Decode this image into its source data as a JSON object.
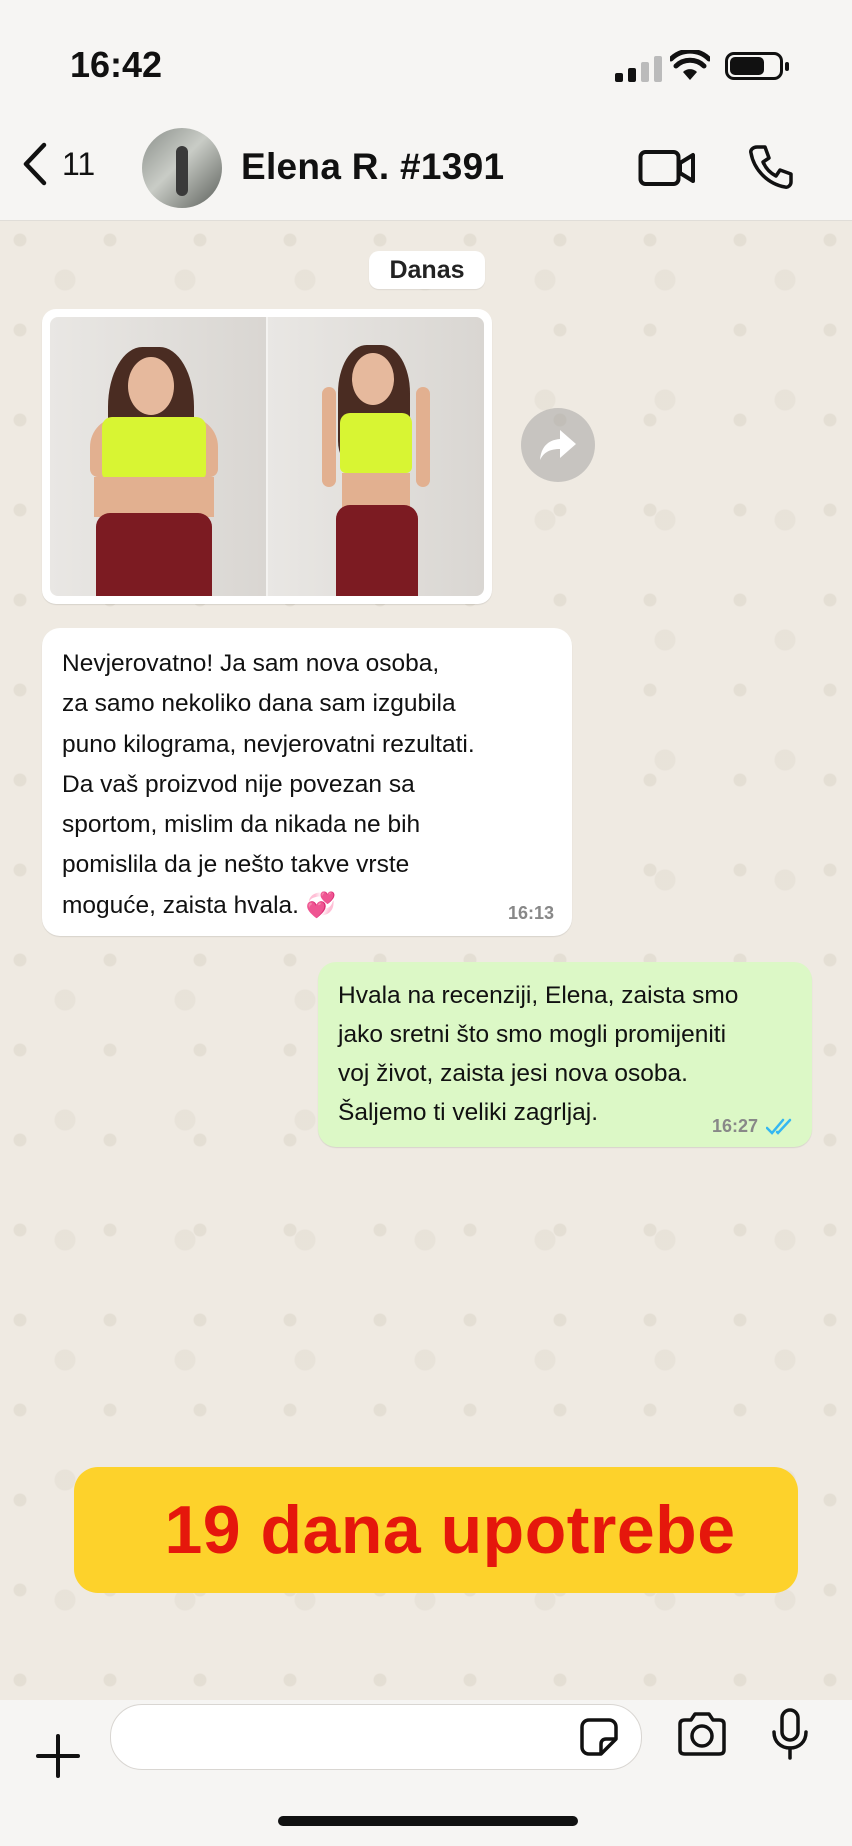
{
  "status_bar": {
    "time": "16:42"
  },
  "header": {
    "back_count": "11",
    "contact_name": "Elena R. #1391"
  },
  "chat": {
    "date_chip": "Danas",
    "incoming": {
      "text": "Nevjerovatno! Ja sam nova osoba,\nza samo nekoliko dana sam izgubila\npuno kilograma, nevjerovatni rezultati.\nDa vaš proizvod nije povezan sa\nsportom, mislim da nikada ne bih\npomislila da je nešto takve vrste\nmoguće, zaista hvala. 💞",
      "time": "16:13"
    },
    "outgoing": {
      "text": "Hvala na recenziji, Elena, zaista smo\njako sretni što smo mogli promijeniti\nvoj život, zaista jesi nova osoba.\nŠaljemo ti veliki zagrljaj.",
      "time": "16:27"
    }
  },
  "banner": {
    "text": "19 dana upotrebe"
  },
  "composer": {
    "placeholder": ""
  },
  "colors": {
    "outgoing_bubble": "#dcf8c6",
    "read_ticks": "#34b7f1",
    "banner_bg": "#fdd22b",
    "banner_text": "#e5170c"
  },
  "icons": [
    "back-chevron-icon",
    "video-call-icon",
    "phone-icon",
    "forward-icon",
    "double-check-icon",
    "plus-icon",
    "sticker-icon",
    "camera-icon",
    "microphone-icon"
  ]
}
